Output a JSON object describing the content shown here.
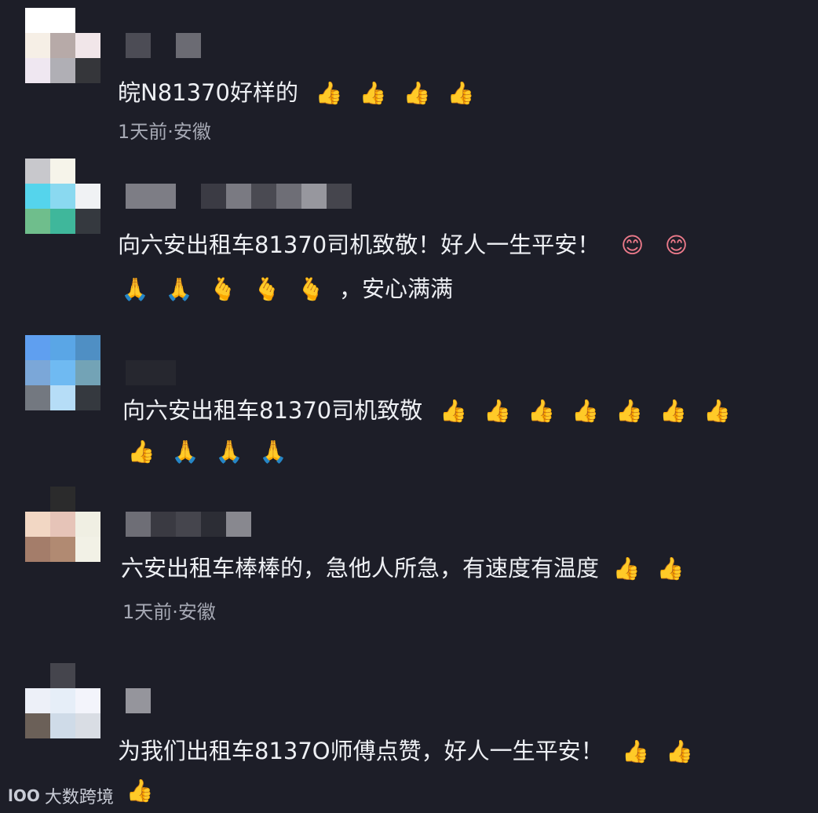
{
  "comments": [
    {
      "text": "皖N81370好样的",
      "emoji_line1": [
        "thumbs-up",
        "thumbs-up",
        "thumbs-up",
        "thumbs-up"
      ],
      "meta": "1天前·安徽"
    },
    {
      "text": "向六安出租车81370司机致敬！好人一生平安！",
      "emoji_line1": [
        "blush",
        "blush"
      ],
      "emoji_line2": [
        "pray",
        "pray",
        "finger-heart",
        "finger-heart",
        "finger-heart"
      ],
      "line2_text": "，安心满满"
    },
    {
      "text": "向六安出租车81370司机致敬",
      "emoji_line1": [
        "thumbs-up",
        "thumbs-up",
        "thumbs-up",
        "thumbs-up",
        "thumbs-up",
        "thumbs-up",
        "thumbs-up"
      ],
      "emoji_line2": [
        "thumbs-up",
        "pray",
        "pray",
        "pray"
      ]
    },
    {
      "text": "六安出租车棒棒的，急他人所急，有速度有温度",
      "emoji_line1": [
        "thumbs-up",
        "thumbs-up"
      ],
      "meta": "1天前·安徽"
    },
    {
      "text": "为我们出租车8137O师傅点赞，好人一生平安！",
      "emoji_line1": [
        "thumbs-up",
        "thumbs-up"
      ],
      "emoji_line2": [
        "thumbs-up"
      ]
    }
  ],
  "glyphs": {
    "thumbs-up": "👍",
    "pray": "🙏",
    "finger-heart": "🫰",
    "blush": "😊"
  },
  "watermark": {
    "logo": "lOO",
    "text": "大数跨境"
  }
}
